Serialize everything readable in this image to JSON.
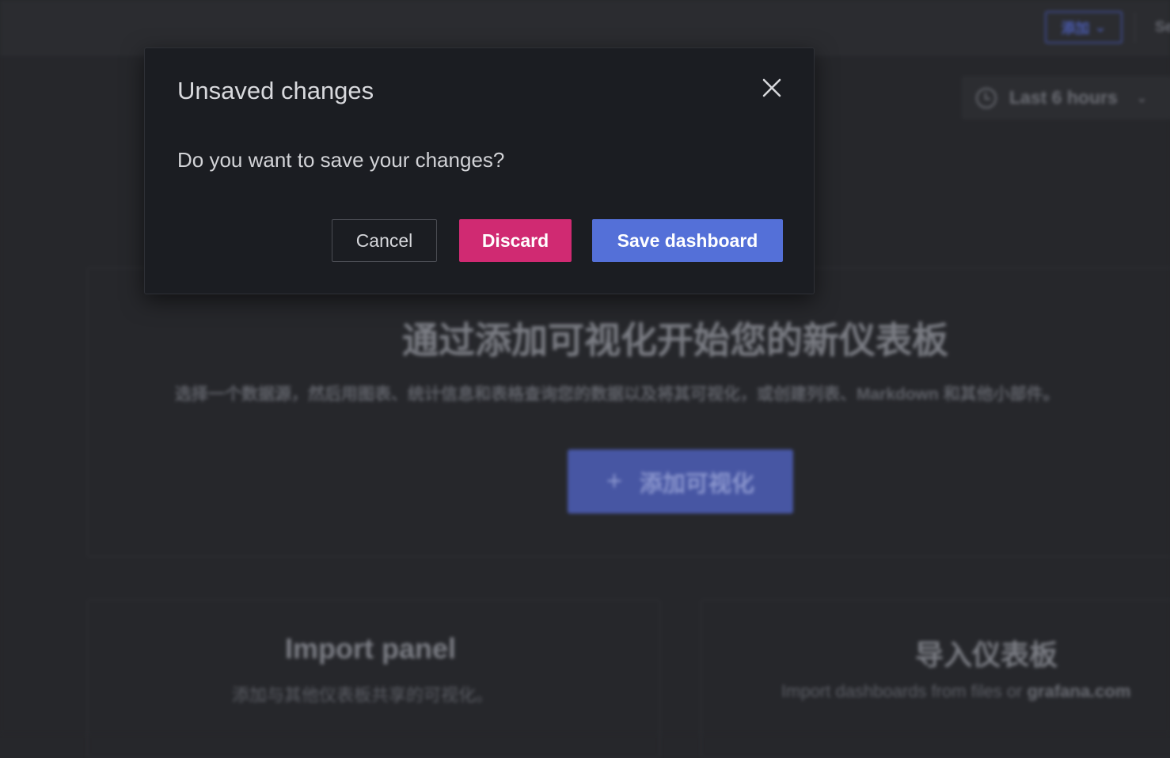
{
  "topbar": {
    "add_label": "添加",
    "settings_label": "Se"
  },
  "time_picker": {
    "label": "Last 6 hours"
  },
  "empty_state": {
    "title": "通过添加可视化开始您的新仪表板",
    "description": "选择一个数据源，然后用图表、统计信息和表格查询您的数据以及将其可视化，或创建列表、Markdown 和其他小部件。",
    "add_button_label": "添加可视化"
  },
  "cards": {
    "import_panel_title": "Import panel",
    "import_panel_desc": "添加与其他仪表板共享的可视化。",
    "import_dashboard_title": "导入仪表板",
    "import_dashboard_desc": "Import dashboards from files or ",
    "import_dashboard_link": "grafana.com"
  },
  "modal": {
    "title": "Unsaved changes",
    "message": "Do you want to save your changes?",
    "cancel_label": "Cancel",
    "discard_label": "Discard",
    "save_label": "Save dashboard"
  },
  "colors": {
    "discard": "#d02a72",
    "save": "#5470d8",
    "modal_bg": "#1b1d22"
  }
}
